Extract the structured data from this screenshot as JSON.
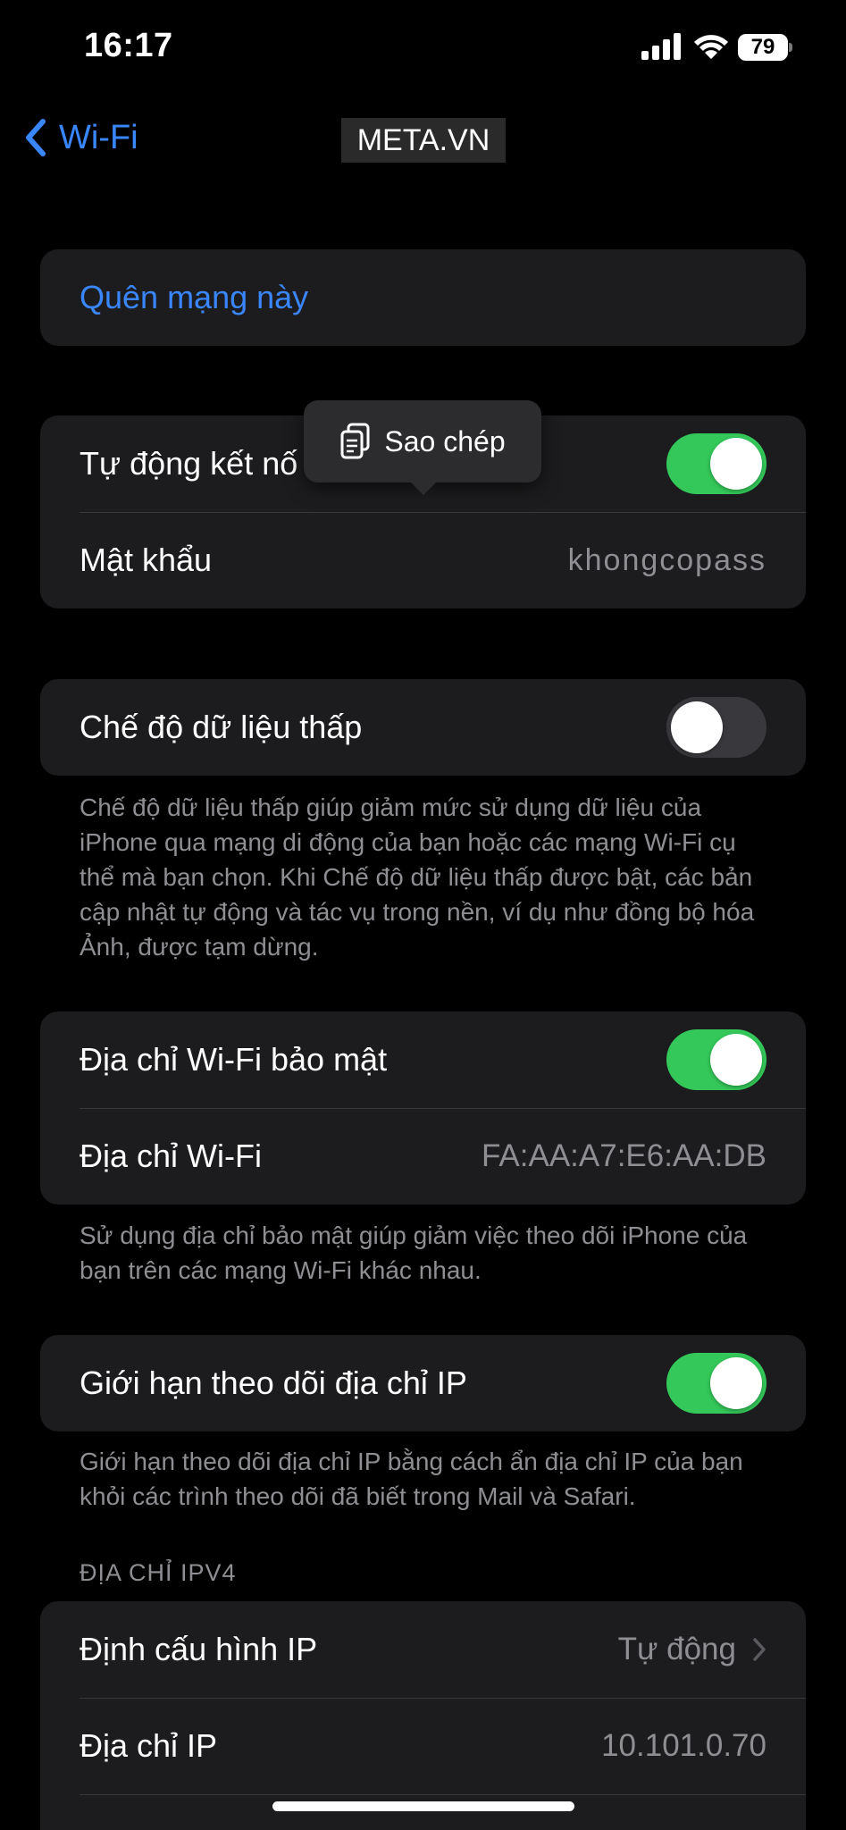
{
  "status_bar": {
    "time": "16:17",
    "battery": "79"
  },
  "nav": {
    "back_label": "Wi-Fi",
    "watermark": "META.VN"
  },
  "forget": {
    "label": "Quên mạng này"
  },
  "group1": {
    "auto_join_label": "Tự động kết nố",
    "auto_join_on": true,
    "password_label": "Mật khẩu",
    "password_value": "khongcopass"
  },
  "popup": {
    "label": "Sao chép"
  },
  "low_data": {
    "label": "Chế độ dữ liệu thấp",
    "on": false,
    "footnote": "Chế độ dữ liệu thấp giúp giảm mức sử dụng dữ liệu của iPhone qua mạng di động của bạn hoặc các mạng Wi-Fi cụ thể mà bạn chọn. Khi Chế độ dữ liệu thấp được bật, các bản cập nhật tự động và tác vụ trong nền, ví dụ như đồng bộ hóa Ảnh, được tạm dừng."
  },
  "private_addr": {
    "label": "Địa chỉ Wi-Fi bảo mật",
    "on": true,
    "wifi_addr_label": "Địa chỉ Wi-Fi",
    "wifi_addr_value": "FA:AA:A7:E6:AA:DB",
    "footnote": "Sử dụng địa chỉ bảo mật giúp giảm việc theo dõi iPhone của bạn trên các mạng Wi-Fi khác nhau."
  },
  "limit_ip": {
    "label": "Giới hạn theo dõi địa chỉ IP",
    "on": true,
    "footnote": "Giới hạn theo dõi địa chỉ IP bằng cách ẩn địa chỉ IP của bạn khỏi các trình theo dõi đã biết trong Mail và Safari."
  },
  "ipv4": {
    "header": "ĐỊA CHỈ IPV4",
    "config_label": "Định cấu hình IP",
    "config_value": "Tự động",
    "ip_label": "Địa chỉ IP",
    "ip_value": "10.101.0.70"
  },
  "colors": {
    "accent": "#3a86ff",
    "toggle_on": "#34c759",
    "group_bg": "#1c1c1e"
  }
}
